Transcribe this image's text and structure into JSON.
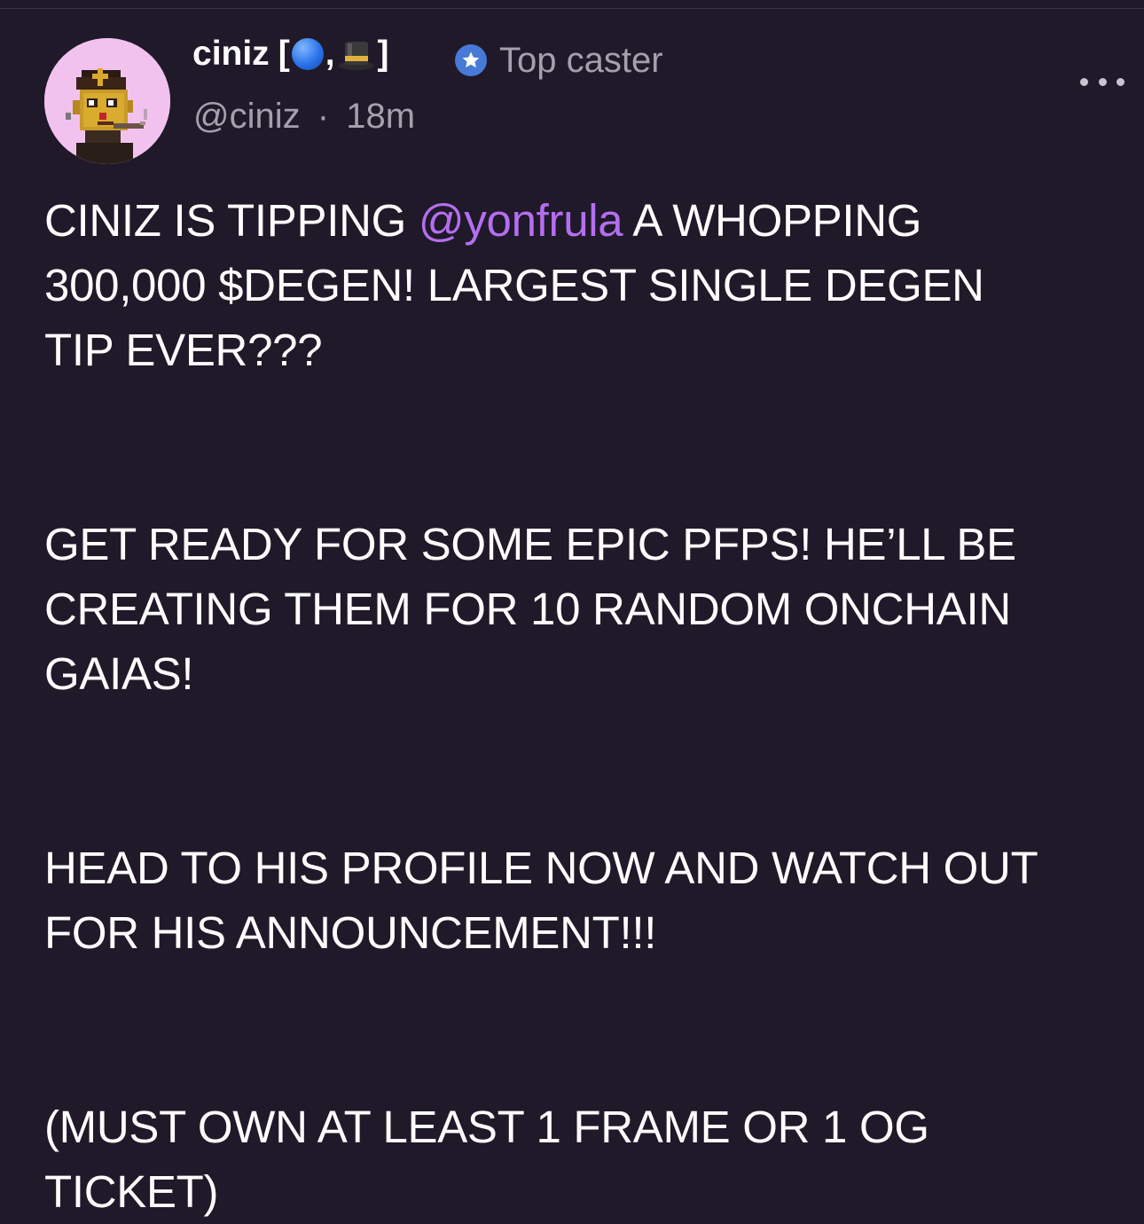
{
  "author": {
    "name": "ciniz",
    "name_bracket_open": "[",
    "name_separator": ",",
    "name_bracket_close": "]",
    "name_emojis": [
      "blue-circle-emoji",
      "top-hat-emoji"
    ],
    "handle": "@ciniz",
    "separator": "·",
    "time": "18m",
    "badge_label": "Top caster",
    "badge_color": "#4779d6"
  },
  "cast": {
    "paragraphs": [
      {
        "lines": [
          {
            "pre": "CINIZ IS TIPPING ",
            "mention": "@yonfrula",
            "post": " A WHOPPING"
          },
          {
            "text": "300,000 $DEGEN! LARGEST SINGLE DEGEN"
          },
          {
            "text": "TIP EVER???"
          }
        ]
      },
      {
        "lines": [
          {
            "text": "GET READY FOR SOME EPIC PFPS! HE’LL BE"
          },
          {
            "text": "CREATING THEM FOR 10 RANDOM ONCHAIN"
          },
          {
            "text": "GAIAS!"
          }
        ]
      },
      {
        "lines": [
          {
            "text": "HEAD TO HIS PROFILE NOW AND WATCH OUT"
          },
          {
            "text": "FOR HIS ANNOUNCEMENT!!!"
          }
        ]
      },
      {
        "lines": [
          {
            "text": "(MUST OWN AT LEAST 1 FRAME OR 1 OG"
          },
          {
            "text": "TICKET)"
          }
        ]
      }
    ]
  },
  "colors": {
    "background": "#1f1929",
    "mention": "#b46ef0",
    "muted_text": "#a59fae",
    "avatar_background": "#f2c2ef"
  },
  "icons": {
    "more": "more-horizontal-icon",
    "badge": "star-badge-icon"
  }
}
